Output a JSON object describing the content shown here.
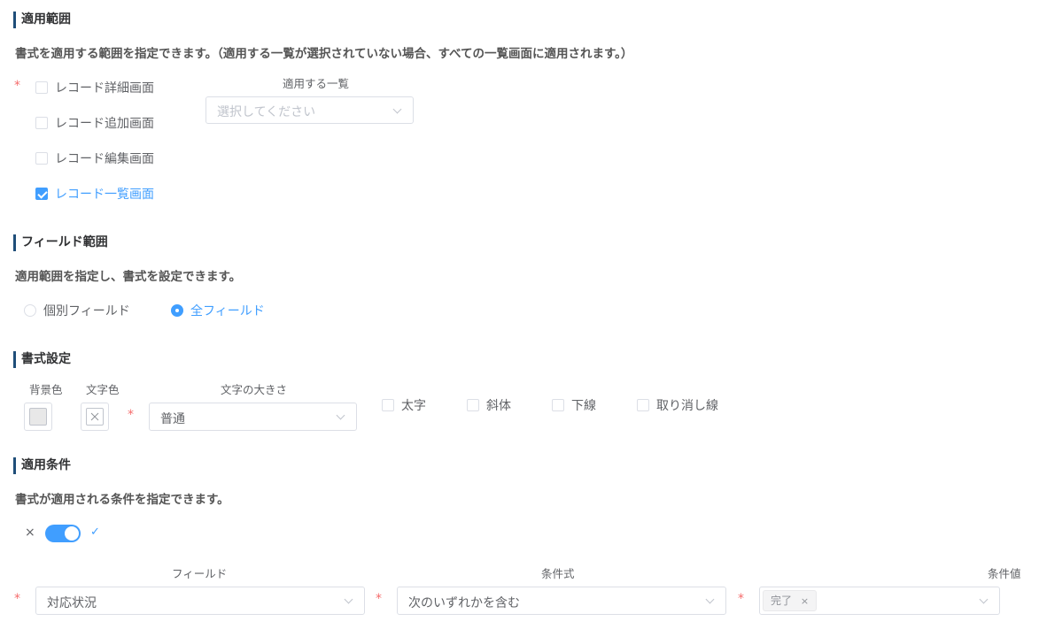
{
  "scope": {
    "title": "適用範囲",
    "description": "書式を適用する範囲を指定できます。（適用する一覧が選択されていない場合、すべての一覧画面に適用されます。）",
    "required_mark": "*",
    "options": [
      {
        "label": "レコード詳細画面",
        "checked": false
      },
      {
        "label": "レコード追加画面",
        "checked": false
      },
      {
        "label": "レコード編集画面",
        "checked": false
      },
      {
        "label": "レコード一覧画面",
        "checked": true
      }
    ],
    "list_select": {
      "label": "適用する一覧",
      "placeholder": "選択してください"
    }
  },
  "field_scope": {
    "title": "フィールド範囲",
    "description": "適用範囲を指定し、書式を設定できます。",
    "options": [
      {
        "label": "個別フィールド",
        "checked": false
      },
      {
        "label": "全フィールド",
        "checked": true
      }
    ]
  },
  "format": {
    "title": "書式設定",
    "bg_color_label": "背景色",
    "text_color_label": "文字色",
    "font_size_label": "文字の大きさ",
    "required_mark": "*",
    "font_size_value": "普通",
    "styles": [
      {
        "label": "太字",
        "checked": false
      },
      {
        "label": "斜体",
        "checked": false
      },
      {
        "label": "下線",
        "checked": false
      },
      {
        "label": "取り消し線",
        "checked": false
      }
    ]
  },
  "condition": {
    "title": "適用条件",
    "description": "書式が適用される条件を指定できます。",
    "toggle": {
      "off_icon": "×",
      "on_icon": "✓",
      "on": true
    },
    "field_label": "フィールド",
    "operator_label": "条件式",
    "value_label": "条件値",
    "required_mark": "*",
    "field_value": "対応状況",
    "operator_value": "次のいずれかを含む",
    "value_tags": [
      {
        "label": "完了",
        "remove_icon": "×"
      }
    ]
  },
  "colors": {
    "accent": "#409eff",
    "section_bar": "#1f4e79",
    "required": "#f56c6c"
  }
}
